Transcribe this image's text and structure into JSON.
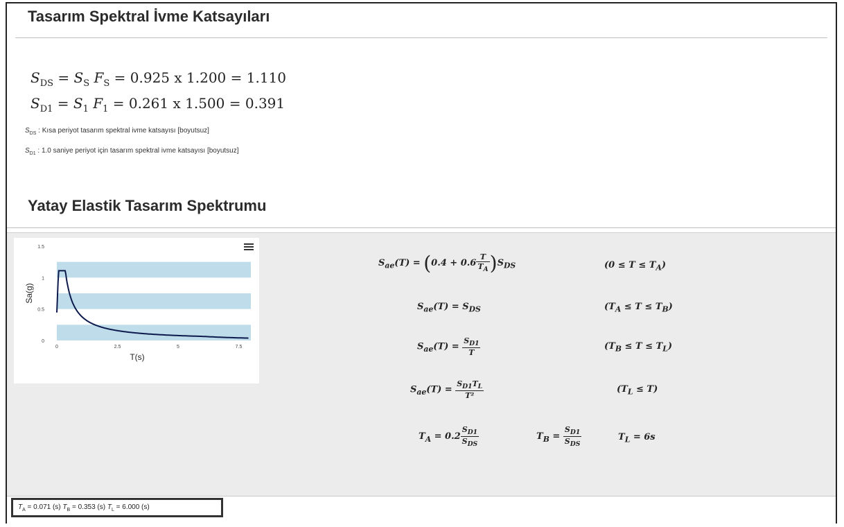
{
  "section1": {
    "title": "Tasarım Spektral İvme Katsayıları",
    "eq_sds": {
      "lhs": "S",
      "lhs_sub": "DS",
      "mid1": " = ",
      "ss": "S",
      "ss_sub": "S",
      "fs": "F",
      "fs_sub": "S",
      "rhs": " = 0.925 x 1.200 = 1.110"
    },
    "eq_sd1": {
      "lhs": "S",
      "lhs_sub": "D1",
      "mid1": " = ",
      "s1": "S",
      "s1_sub": "1",
      "f1": "F",
      "f1_sub": "1",
      "rhs": " = 0.261 x 1.500 = 0.391"
    },
    "note_sds": {
      "sym": "S",
      "sub": "DS",
      "text": " : Kısa periyot tasarım spektral ivme katsayısı [boyutsuz]"
    },
    "note_sd1": {
      "sym": "S",
      "sub": "D1",
      "text": " : 1.0 saniye periyot için tasarım spektral ivme katsayısı [boyutsuz]"
    }
  },
  "section2": {
    "title": "Yatay Elastik Tasarım Spektrumu"
  },
  "formulas": {
    "f1_lhs": "S",
    "f1_lhs_sub": "ae",
    "f1_arg": "(T) = ",
    "f1_body1": "0.4 + 0.6",
    "f1_frac_n": "T",
    "f1_frac_d": "T",
    "f1_frac_d_sub": "A",
    "f1_sds": "S",
    "f1_sds_sub": "DS",
    "f1_cond": "(0 ≤ T ≤ T",
    "f1_cond_sub": "A",
    "f1_cond_end": ")",
    "f2_text": "(T) = S",
    "f2_sub": "DS",
    "f2_cond_a": "(T",
    "f2_cond_a_sub": "A",
    "f2_cond_b": " ≤ T ≤ T",
    "f2_cond_b_sub": "B",
    "f2_cond_end": ")",
    "f3_text": "(T) = ",
    "f3_n": "S",
    "f3_n_sub": "D1",
    "f3_d": "T",
    "f3_cond_a": "(T",
    "f3_cond_a_sub": "B",
    "f3_cond_b": " ≤ T ≤ T",
    "f3_cond_b_sub": "L",
    "f3_cond_end": ")",
    "f4_text": "(T) = ",
    "f4_n": "S",
    "f4_n_sub": "D1",
    "f4_n2": "T",
    "f4_n2_sub": "L",
    "f4_d": "T²",
    "f4_cond_a": "(T",
    "f4_cond_a_sub": "L",
    "f4_cond_end": " ≤ T)",
    "ta_lhs": "T",
    "ta_lhs_sub": "A",
    "ta_mid": " = 0.2",
    "ta_n": "S",
    "ta_n_sub": "D1",
    "ta_d": "S",
    "ta_d_sub": "DS",
    "tb_lhs": "T",
    "tb_lhs_sub": "B",
    "tb_mid": " = ",
    "tb_n": "S",
    "tb_n_sub": "D1",
    "tb_d": "S",
    "tb_d_sub": "DS",
    "tl_lhs": "T",
    "tl_lhs_sub": "L",
    "tl_rhs": " = 6s"
  },
  "footer": {
    "ta_sym": "T",
    "ta_sub": "A",
    "ta_val": " = 0.071 (s)  ",
    "tb_sym": "T",
    "tb_sub": "B",
    "tb_val": " = 0.353 (s)  ",
    "tl_sym": "T",
    "tl_sub": "L",
    "tl_val": " = 6.000 (s)"
  },
  "chart_data": {
    "type": "line",
    "xlabel": "T(s)",
    "ylabel": "Sa(g)",
    "xlim": [
      0,
      8
    ],
    "ylim": [
      0,
      1.5
    ],
    "xticks": [
      "0",
      "2.5",
      "5",
      "7.5"
    ],
    "yticks": [
      "0",
      "0.5",
      "1",
      "1.5"
    ],
    "SDS": 1.11,
    "SD1": 0.391,
    "TA": 0.071,
    "TB": 0.353,
    "TL": 6.0,
    "series_color": "#0d1a4d",
    "band_color": "#bfdceb",
    "menu_icon": "hamburger-menu-icon"
  }
}
